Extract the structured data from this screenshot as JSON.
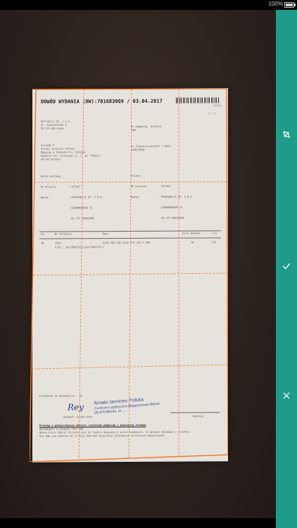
{
  "status_bar": {
    "battery_percent": "100%"
  },
  "document": {
    "title": "DOWÓD WYDANIA (DW):701683069 / 03.04.2017",
    "copy_label": "KOPIA",
    "page": "1 / 1",
    "block_sender": [
      "Pofrakcji Sp. z o.o.",
      "Ul. Dzwonkowska 6",
      "02-275 Warszawa"
    ],
    "block_receiver_no": [
      "Nr Zamawiaj. Klienta",
      "SON"
    ],
    "block_carrier": [
      "Sieradz P.",
      "Arvato services Polska",
      "Magazyn w Pozbodo Prz. Kioska",
      "Pogórze Str. Pofywała ul. C. ms. Bhosle",
      "56-675 Blonie"
    ],
    "block_order": [
      "Nr Zlecenia wysyłki / Data",
      "5166/2016"
    ],
    "block_address_left": [
      "Adres dostawy:",
      "Nr Klienta        : 547507",
      "Nazwa             : PROFRAKCJI SP. Z O.O.",
      "                    DZWONKOWSKA 11",
      "                    02-275 WARSZAWA"
    ],
    "block_address_right": [
      "Klient:",
      "Nr Klienta        : 547507",
      "Nazwa             : PROFRAKCJI SP. Z O.O.",
      "                    DZWONKOWSKA 11",
      "                    02-275 WARSZAWA"
    ],
    "table_header": [
      "Lp.",
      "Nr Artykułu",
      "Opis",
      "Ilość Wydana",
      "J.m"
    ],
    "table_row": [
      "10",
      "1483",
      "SZIN SOS ESE SZIA 1/5-LER 5 PIK",
      "10",
      "SZT"
    ],
    "table_subrow": "E/ES : 1617096758/1/2617096755/1",
    "footer_left": "Produktów na dokumencie :    10",
    "footer_issued": "Wydawał: Blood Anna",
    "footer_right": "Odebrał",
    "footer_notes": [
      "Prosimy o potwierdzenie odbioru czytelnym podpisem i pieczęcią firmową",
      "Składowano w związku 3415 DRE",
      "Nazwa Klucz Odbiór Klienta jest do Punktu dyspozycji przez niedzieli. W sprawie Zmianami i telefon:",
      "61w 606 pod numerem 16 21 mies Pakinek wszystkie informacje od których Konsultanów"
    ],
    "stamp_lines": [
      "Arvato services Polska",
      "Centrum Logistyczno-Magazynowe Błonie",
      "05-870 Błonie, ul. ..."
    ],
    "signature": "Rey"
  },
  "toolbar": {
    "crop_icon": "crop-rotate-icon",
    "confirm_icon": "check-icon",
    "cancel_icon": "close-icon"
  },
  "colors": {
    "accent": "#1e9b8a",
    "crop_line": "#f07a2f",
    "background": "#2f2520"
  }
}
